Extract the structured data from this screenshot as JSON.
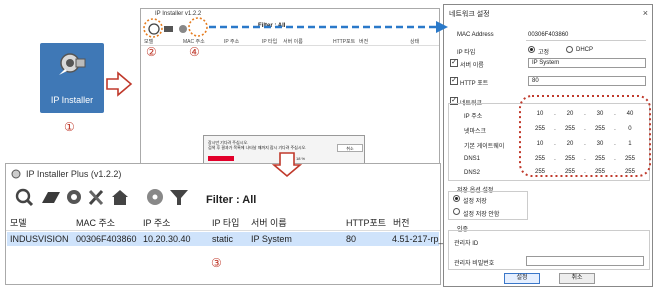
{
  "desktop": {
    "shortcut_label": "IP Installer",
    "step1": "①",
    "step2": "②",
    "step3": "③",
    "step4": "④"
  },
  "bg_window": {
    "title": "IP Installer v1.2.2",
    "toolbar_label": "모델",
    "filter_label": "Filter : All",
    "columns": [
      "MAC 주소",
      "IP 주소",
      "IP 타입",
      "서버 이름",
      "HTTP포트",
      "버전",
      "상태"
    ],
    "dialog": {
      "line1": "장시만 기다려 주십시오.",
      "line2": "검색 후 결과가 목록에 나타날 때까지 잠시 기다려 주십시오.",
      "percent": "18 %",
      "cancel": "취소"
    }
  },
  "main_window": {
    "title": "IP Installer Plus (v1.2.2)",
    "filter_label": "Filter :  All",
    "columns": [
      "모델",
      "MAC 주소",
      "IP 주소",
      "IP 타입",
      "서버 이름",
      "HTTP포트",
      "버전"
    ],
    "row": [
      "INDUSVISION",
      "00306F403860",
      "10.20.30.40",
      "static",
      "IP System",
      "80",
      "4.51-217-rp_N"
    ],
    "tools": [
      "search-icon",
      "eraser-icon",
      "gear-icon",
      "tools-icon",
      "home-icon",
      "disc-icon",
      "filter-icon"
    ]
  },
  "net_dialog": {
    "title": "네트워크 설정",
    "close": "×",
    "mac_label": "MAC Address",
    "mac_value": "00306F403860",
    "ip_type_label": "IP 타입",
    "ip_type_static": "고정",
    "ip_type_dhcp": "DHCP",
    "server_name_label": "서버 이름",
    "server_name_value": "IP System",
    "http_port_label": "HTTP 포트",
    "http_port_value": "80",
    "network_label": "네트워크",
    "ip_label": "IP 주소",
    "ip": [
      "10",
      "20",
      "30",
      "40"
    ],
    "netmask_label": "넷마스크",
    "netmask": [
      "255",
      "255",
      "255",
      "0"
    ],
    "gateway_label": "기본 게이트웨이",
    "gateway": [
      "10",
      "20",
      "30",
      "1"
    ],
    "dns1_label": "DNS1",
    "dns1": [
      "255",
      "255",
      "255",
      "255"
    ],
    "dns2_label": "DNS2",
    "dns2": [
      "255",
      "255",
      "255",
      "255"
    ],
    "save_option_label": "저장 옵션 설정",
    "save_option_on": "설정 저장",
    "save_option_off": "설정 저장 안함",
    "auth_label": "인증",
    "admin_id_label": "관리자 ID",
    "admin_pw_label": "관리자 비밀번호",
    "ok_button": "설정",
    "cancel_button": "취소"
  },
  "colors": {
    "accent_red": "#c0392b",
    "arrow_blue": "#2a79c9",
    "highlight_red": "#c0392b",
    "row_select": "#cfe3fb"
  }
}
